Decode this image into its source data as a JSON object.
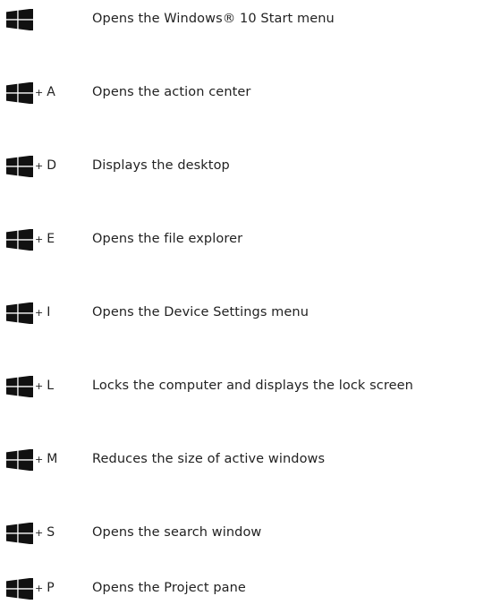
{
  "colors": {
    "icon": "#111111",
    "text": "#222222",
    "background": "#ffffff"
  },
  "icon_name": "windows-logo-icon",
  "shortcuts": [
    {
      "plus": "",
      "key": "",
      "description": "Opens the Windows® 10 Start menu"
    },
    {
      "plus": "+",
      "key": "A",
      "description": "Opens the action center"
    },
    {
      "plus": "+",
      "key": "D",
      "description": "Displays the desktop"
    },
    {
      "plus": "+",
      "key": "E",
      "description": "Opens the file explorer"
    },
    {
      "plus": "+",
      "key": "I",
      "description": "Opens the Device Settings menu"
    },
    {
      "plus": "+",
      "key": "L",
      "description": "Locks the computer and displays the lock screen"
    },
    {
      "plus": "+",
      "key": "M",
      "description": "Reduces the size of active windows"
    },
    {
      "plus": "+",
      "key": "S",
      "description": "Opens the search window"
    },
    {
      "plus": "+",
      "key": "P",
      "description": "Opens the Project pane"
    }
  ]
}
